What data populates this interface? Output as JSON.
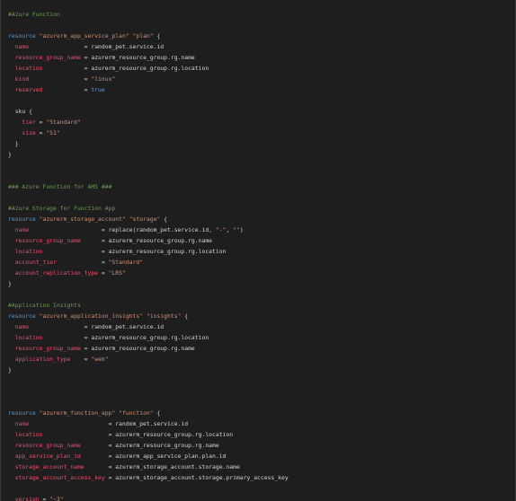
{
  "editor": {
    "lines": [
      [
        {
          "t": "#Azure Function",
          "c": "comment"
        }
      ],
      [],
      [
        {
          "t": "resource ",
          "c": "keyword"
        },
        {
          "t": "\"azurerm_app_service_plan\"",
          "c": "string"
        },
        {
          "t": " ",
          "c": "plain"
        },
        {
          "t": "\"plan\"",
          "c": "string"
        },
        {
          "t": " {",
          "c": "punct"
        }
      ],
      [
        {
          "t": "  ",
          "c": "plain"
        },
        {
          "t": "name",
          "c": "attr"
        },
        {
          "t": "                = random_pet.service.id",
          "c": "plain"
        }
      ],
      [
        {
          "t": "  ",
          "c": "plain"
        },
        {
          "t": "resource_group_name",
          "c": "attr"
        },
        {
          "t": " = azurerm_resource_group.rg.name",
          "c": "plain"
        }
      ],
      [
        {
          "t": "  ",
          "c": "plain"
        },
        {
          "t": "location",
          "c": "attr"
        },
        {
          "t": "            = azurerm_resource_group.rg.location",
          "c": "plain"
        }
      ],
      [
        {
          "t": "  ",
          "c": "plain"
        },
        {
          "t": "kind",
          "c": "attr"
        },
        {
          "t": "                = ",
          "c": "plain"
        },
        {
          "t": "\"linux\"",
          "c": "string"
        }
      ],
      [
        {
          "t": "  ",
          "c": "plain"
        },
        {
          "t": "reserved",
          "c": "attr"
        },
        {
          "t": "            = ",
          "c": "plain"
        },
        {
          "t": "true",
          "c": "bool"
        }
      ],
      [],
      [
        {
          "t": "  sku {",
          "c": "plain"
        }
      ],
      [
        {
          "t": "    ",
          "c": "plain"
        },
        {
          "t": "tier",
          "c": "attr"
        },
        {
          "t": " = ",
          "c": "plain"
        },
        {
          "t": "\"Standard\"",
          "c": "string"
        }
      ],
      [
        {
          "t": "    ",
          "c": "plain"
        },
        {
          "t": "size",
          "c": "attr"
        },
        {
          "t": " = ",
          "c": "plain"
        },
        {
          "t": "\"S1\"",
          "c": "string"
        }
      ],
      [
        {
          "t": "  }",
          "c": "punct"
        }
      ],
      [
        {
          "t": "}",
          "c": "punct"
        }
      ],
      [],
      [],
      [
        {
          "t": "### Azure Function for AMS ###",
          "c": "comment"
        }
      ],
      [],
      [
        {
          "t": "#Azure Storage for Function App",
          "c": "comment"
        }
      ],
      [
        {
          "t": "resource ",
          "c": "keyword"
        },
        {
          "t": "\"azurerm_storage_account\"",
          "c": "string"
        },
        {
          "t": " ",
          "c": "plain"
        },
        {
          "t": "\"storage\"",
          "c": "string"
        },
        {
          "t": " {",
          "c": "punct"
        }
      ],
      [
        {
          "t": "  ",
          "c": "plain"
        },
        {
          "t": "name",
          "c": "attr"
        },
        {
          "t": "                     = replace(random_pet.service.id, ",
          "c": "plain"
        },
        {
          "t": "\"-\"",
          "c": "string"
        },
        {
          "t": ", ",
          "c": "plain"
        },
        {
          "t": "\"\"",
          "c": "string"
        },
        {
          "t": ")",
          "c": "plain"
        }
      ],
      [
        {
          "t": "  ",
          "c": "plain"
        },
        {
          "t": "resource_group_name",
          "c": "attr"
        },
        {
          "t": "      = azurerm_resource_group.rg.name",
          "c": "plain"
        }
      ],
      [
        {
          "t": "  ",
          "c": "plain"
        },
        {
          "t": "location",
          "c": "attr"
        },
        {
          "t": "                 = azurerm_resource_group.rg.location",
          "c": "plain"
        }
      ],
      [
        {
          "t": "  ",
          "c": "plain"
        },
        {
          "t": "account_tier",
          "c": "attr"
        },
        {
          "t": "             = ",
          "c": "plain"
        },
        {
          "t": "\"Standard\"",
          "c": "string"
        }
      ],
      [
        {
          "t": "  ",
          "c": "plain"
        },
        {
          "t": "account_replication_type",
          "c": "attr"
        },
        {
          "t": " = ",
          "c": "plain"
        },
        {
          "t": "\"LRS\"",
          "c": "string"
        }
      ],
      [
        {
          "t": "}",
          "c": "punct"
        }
      ],
      [],
      [
        {
          "t": "#Application Insights",
          "c": "comment"
        }
      ],
      [
        {
          "t": "resource ",
          "c": "keyword"
        },
        {
          "t": "\"azurerm_application_insights\"",
          "c": "string"
        },
        {
          "t": " ",
          "c": "plain"
        },
        {
          "t": "\"insights\"",
          "c": "string"
        },
        {
          "t": " {",
          "c": "punct"
        }
      ],
      [
        {
          "t": "  ",
          "c": "plain"
        },
        {
          "t": "name",
          "c": "attr"
        },
        {
          "t": "                = random_pet.service.id",
          "c": "plain"
        }
      ],
      [
        {
          "t": "  ",
          "c": "plain"
        },
        {
          "t": "location",
          "c": "attr"
        },
        {
          "t": "            = azurerm_resource_group.rg.location",
          "c": "plain"
        }
      ],
      [
        {
          "t": "  ",
          "c": "plain"
        },
        {
          "t": "resource_group_name",
          "c": "attr"
        },
        {
          "t": " = azurerm_resource_group.rg.name",
          "c": "plain"
        }
      ],
      [
        {
          "t": "  ",
          "c": "plain"
        },
        {
          "t": "application_type",
          "c": "attr"
        },
        {
          "t": "    = ",
          "c": "plain"
        },
        {
          "t": "\"web\"",
          "c": "string"
        }
      ],
      [
        {
          "t": "}",
          "c": "punct"
        }
      ],
      [],
      [],
      [],
      [
        {
          "t": "resource ",
          "c": "keyword"
        },
        {
          "t": "\"azurerm_function_app\"",
          "c": "string"
        },
        {
          "t": " ",
          "c": "plain"
        },
        {
          "t": "\"function\"",
          "c": "string"
        },
        {
          "t": " {",
          "c": "punct"
        }
      ],
      [
        {
          "t": "  ",
          "c": "plain"
        },
        {
          "t": "name",
          "c": "attr"
        },
        {
          "t": "                       = random_pet.service.id",
          "c": "plain"
        }
      ],
      [
        {
          "t": "  ",
          "c": "plain"
        },
        {
          "t": "location",
          "c": "attr"
        },
        {
          "t": "                   = azurerm_resource_group.rg.location",
          "c": "plain"
        }
      ],
      [
        {
          "t": "  ",
          "c": "plain"
        },
        {
          "t": "resource_group_name",
          "c": "attr"
        },
        {
          "t": "        = azurerm_resource_group.rg.name",
          "c": "plain"
        }
      ],
      [
        {
          "t": "  ",
          "c": "plain"
        },
        {
          "t": "app_service_plan_id",
          "c": "attr"
        },
        {
          "t": "        = azurerm_app_service_plan.plan.id",
          "c": "plain"
        }
      ],
      [
        {
          "t": "  ",
          "c": "plain"
        },
        {
          "t": "storage_account_name",
          "c": "attr"
        },
        {
          "t": "       = azurerm_storage_account.storage.name",
          "c": "plain"
        }
      ],
      [
        {
          "t": "  ",
          "c": "plain"
        },
        {
          "t": "storage_account_access_key",
          "c": "attr"
        },
        {
          "t": " = azurerm_storage_account.storage.primary_access_key",
          "c": "plain"
        }
      ],
      [],
      [
        {
          "t": "  ",
          "c": "plain"
        },
        {
          "t": "version",
          "c": "attr"
        },
        {
          "t": " = ",
          "c": "plain"
        },
        {
          "t": "\"~3\"",
          "c": "string"
        }
      ]
    ]
  },
  "colors": {
    "background": "#1e1e1e",
    "comment": "#6a9955",
    "keyword": "#569cd6",
    "string": "#ce9178",
    "attribute": "#f14c6b",
    "text": "#d4d4d4"
  }
}
